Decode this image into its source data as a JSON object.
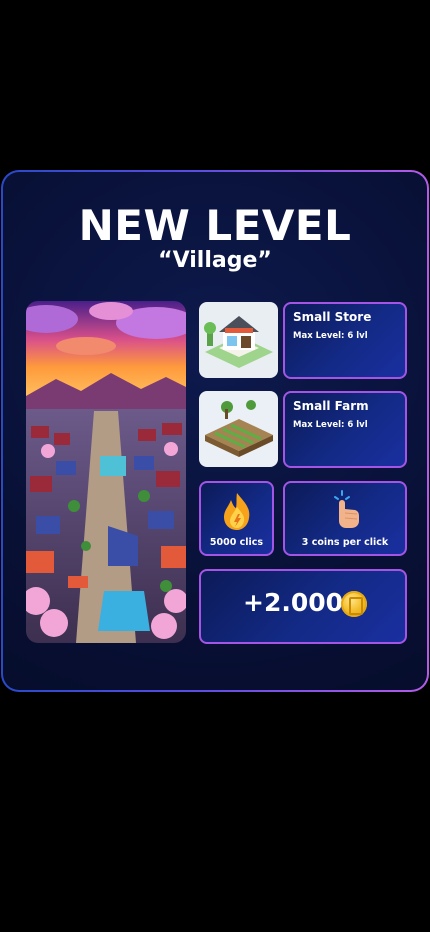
{
  "header": {
    "title": "NEW LEVEL",
    "level_name": "“Village”"
  },
  "hero": {
    "icon": "village-artwork-image"
  },
  "unlocks": [
    {
      "name": "Small Store",
      "max_level": "Max Level: 6 lvl",
      "icon": "store-image"
    },
    {
      "name": "Small Farm",
      "max_level": "Max Level: 6 lvl",
      "icon": "farm-image"
    }
  ],
  "stats": {
    "clicks": {
      "label": "5000 clics",
      "icon": "fire-icon"
    },
    "coins_per_click": {
      "label": "3 coins per click",
      "icon": "tap-hand-icon"
    }
  },
  "reward": {
    "amount": "+2.000",
    "icon": "coin-icon"
  },
  "colors": {
    "accent_border": "#a455e6",
    "card_gradient_start": "#2a49c8",
    "card_gradient_end": "#b55be8",
    "background": "#000000"
  }
}
